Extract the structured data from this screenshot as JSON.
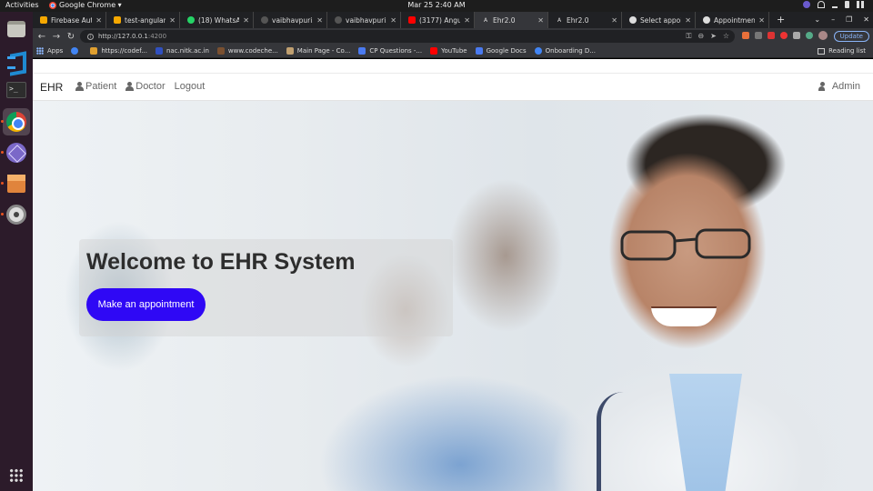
{
  "system": {
    "activities": "Activities",
    "app_name": "Google Chrome ▾",
    "clock": "Mar 25   2:40 AM"
  },
  "browser": {
    "tabs": [
      {
        "title": "Firebase Auth",
        "favicon_color": "#f6a800",
        "active": false
      },
      {
        "title": "test-angular-e",
        "favicon_color": "#f6a800",
        "active": false
      },
      {
        "title": "(18) WhatsApp",
        "favicon_color": "#25d366",
        "active": false
      },
      {
        "title": "vaibhavpuri32",
        "favicon_color": "#555555",
        "active": false
      },
      {
        "title": "vaibhavpuri32",
        "favicon_color": "#555555",
        "active": false
      },
      {
        "title": "(3177) Angular",
        "favicon_color": "#ff0000",
        "active": false
      },
      {
        "title": "Ehr2.0",
        "favicon_color": "#dd0031",
        "active": true
      },
      {
        "title": "Ehr2.0",
        "favicon_color": "#dd0031",
        "active": false
      },
      {
        "title": "Select appoint",
        "favicon_color": "#4285f4",
        "active": false
      },
      {
        "title": "Appointment",
        "favicon_color": "#4285f4",
        "active": false
      }
    ],
    "new_tab": "+",
    "url_host": "http://127.0.0.1",
    "url_port": ":4200",
    "update_label": "Update",
    "bookmarks": [
      {
        "label": "Apps",
        "color": "#8ab4f8"
      },
      {
        "label": "",
        "color": "#4285f4"
      },
      {
        "label": "https://codef...",
        "color": "#e0a030"
      },
      {
        "label": "nac.nitk.ac.in",
        "color": "#3050c0"
      },
      {
        "label": "www.codeche...",
        "color": "#7a5030"
      },
      {
        "label": "Main Page - Co...",
        "color": "#c0a070"
      },
      {
        "label": "CP Questions -...",
        "color": "#4a7af0"
      },
      {
        "label": "YouTube",
        "color": "#ff0000"
      },
      {
        "label": "Google Docs",
        "color": "#4a7af0"
      },
      {
        "label": "Onboarding D...",
        "color": "#4285f4"
      }
    ],
    "reading_list": "Reading list"
  },
  "app": {
    "brand": "EHR",
    "nav": {
      "patient": "Patient",
      "doctor": "Doctor",
      "logout": "Logout",
      "admin": "Admin"
    },
    "hero": {
      "title": "Welcome to EHR System",
      "button": "Make an appointment"
    },
    "colors": {
      "accent": "#2f08f5"
    }
  }
}
